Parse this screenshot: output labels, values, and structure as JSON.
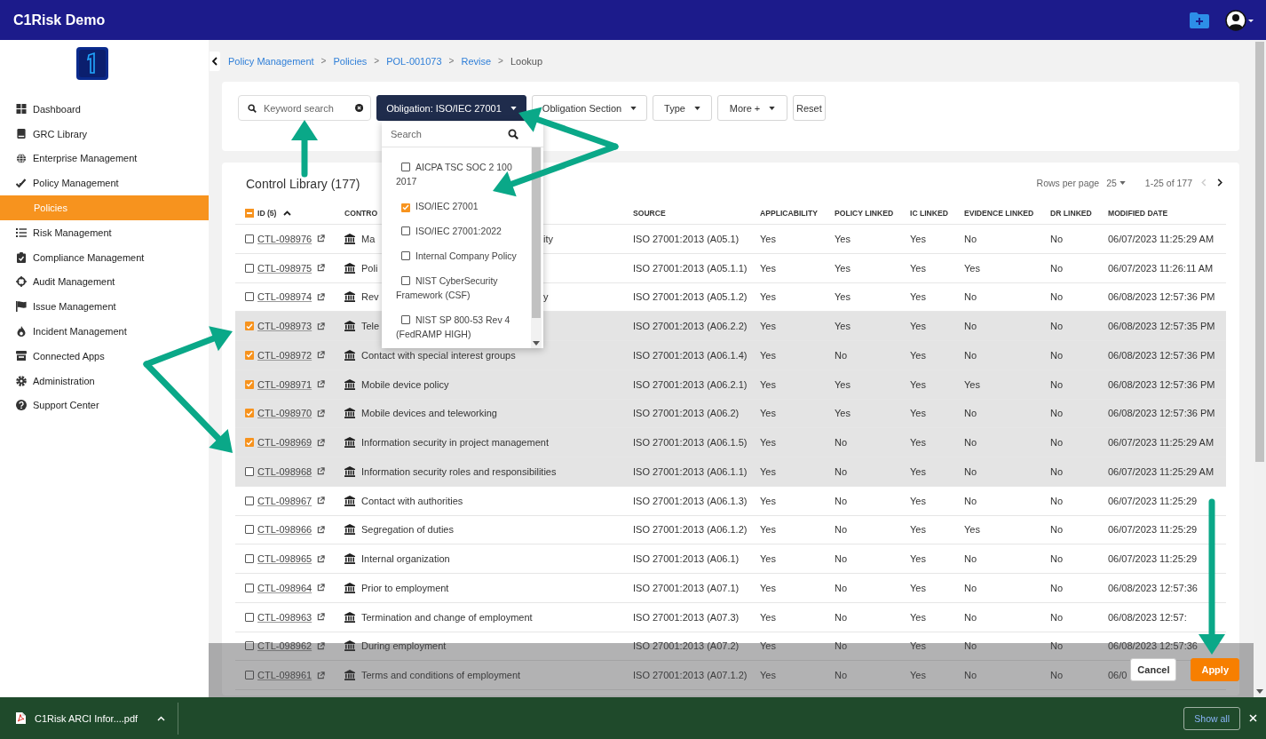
{
  "header": {
    "title": "C1Risk Demo"
  },
  "sidebar": {
    "items": [
      {
        "label": "Dashboard",
        "selected": false
      },
      {
        "label": "GRC Library",
        "selected": false
      },
      {
        "label": "Enterprise Management",
        "selected": false
      },
      {
        "label": "Policy Management",
        "selected": false,
        "children": [
          {
            "label": "Policies",
            "selected": true
          }
        ]
      },
      {
        "label": "Risk Management",
        "selected": false
      },
      {
        "label": "Compliance Management",
        "selected": false
      },
      {
        "label": "Audit Management",
        "selected": false
      },
      {
        "label": "Issue Management",
        "selected": false
      },
      {
        "label": "Incident Management",
        "selected": false
      },
      {
        "label": "Connected Apps",
        "selected": false
      },
      {
        "label": "Administration",
        "selected": false
      },
      {
        "label": "Support Center",
        "selected": false
      }
    ]
  },
  "breadcrumbs": [
    {
      "label": "Policy Management",
      "link": true
    },
    {
      "separator": ">",
      "label": "Policies",
      "link": true
    },
    {
      "separator": ">",
      "label": "POL-001073",
      "link": true
    },
    {
      "separator": ">",
      "label": "Revise",
      "link": true
    },
    {
      "separator": ">",
      "label": "Lookup",
      "link": false
    }
  ],
  "filters": {
    "search": {
      "placeholder": "Keyword search"
    },
    "buttons": [
      {
        "label": "Obligation: ISO/IEC 27001",
        "active": true
      },
      {
        "label": "Obligation Section",
        "active": false
      },
      {
        "label": "Type",
        "active": false
      },
      {
        "label": "More +",
        "active": false
      }
    ],
    "reset": "Reset",
    "dropdown": {
      "search_placeholder": "Search",
      "options": [
        {
          "label": "AICPA TSC SOC 2 100 2017",
          "checked": false
        },
        {
          "label": "ISO/IEC 27001",
          "checked": true
        },
        {
          "label": "ISO/IEC 27001:2022",
          "checked": false
        },
        {
          "label": "Internal Company Policy",
          "checked": false
        },
        {
          "label": "NIST CyberSecurity Framework (CSF)",
          "checked": false
        },
        {
          "label": "NIST SP 800-53 Rev 4 (FedRAMP HIGH)",
          "checked": false
        }
      ]
    }
  },
  "table": {
    "title": "Control Library (177)",
    "rows_per_page_label": "Rows per page",
    "rows_per_page": "25",
    "range": "1-25 of 177",
    "indeterminate": true,
    "columns": [
      "ID (5)",
      "CONTRO",
      "SOURCE",
      "APPLICABILITY",
      "POLICY LINKED",
      "IC LINKED",
      "EVIDENCE LINKED",
      "DR LINKED",
      "MODIFIED DATE"
    ],
    "rows": [
      {
        "id": "CTL-098976",
        "control": "Ma",
        "control_tail": "ity",
        "source": "ISO 27001:2013 (A05.1)",
        "applicability": "Yes",
        "policy_linked": "Yes",
        "ic_linked": "Yes",
        "evidence_linked": "No",
        "dr_linked": "No",
        "modified": "06/07/2023 11:25:29 AM",
        "checked": false,
        "selected": false
      },
      {
        "id": "CTL-098975",
        "control": "Poli",
        "source": "ISO 27001:2013 (A05.1.1)",
        "applicability": "Yes",
        "policy_linked": "Yes",
        "ic_linked": "Yes",
        "evidence_linked": "Yes",
        "dr_linked": "No",
        "modified": "06/07/2023 11:26:11 AM",
        "checked": false,
        "selected": false
      },
      {
        "id": "CTL-098974",
        "control": "Rev",
        "control_tail": "y",
        "source": "ISO 27001:2013 (A05.1.2)",
        "applicability": "Yes",
        "policy_linked": "Yes",
        "ic_linked": "Yes",
        "evidence_linked": "No",
        "dr_linked": "No",
        "modified": "06/08/2023 12:57:36 PM",
        "checked": false,
        "selected": false
      },
      {
        "id": "CTL-098973",
        "control": "Tele",
        "source": "ISO 27001:2013 (A06.2.2)",
        "applicability": "Yes",
        "policy_linked": "Yes",
        "ic_linked": "Yes",
        "evidence_linked": "No",
        "dr_linked": "No",
        "modified": "06/08/2023 12:57:35 PM",
        "checked": true,
        "selected": true
      },
      {
        "id": "CTL-098972",
        "control": "Contact with special interest groups",
        "source": "ISO 27001:2013 (A06.1.4)",
        "applicability": "Yes",
        "policy_linked": "No",
        "ic_linked": "Yes",
        "evidence_linked": "No",
        "dr_linked": "No",
        "modified": "06/08/2023 12:57:36 PM",
        "checked": true,
        "selected": true
      },
      {
        "id": "CTL-098971",
        "control": "Mobile device policy",
        "source": "ISO 27001:2013 (A06.2.1)",
        "applicability": "Yes",
        "policy_linked": "Yes",
        "ic_linked": "Yes",
        "evidence_linked": "Yes",
        "dr_linked": "No",
        "modified": "06/08/2023 12:57:36 PM",
        "checked": true,
        "selected": true
      },
      {
        "id": "CTL-098970",
        "control": "Mobile devices and teleworking",
        "source": "ISO 27001:2013 (A06.2)",
        "applicability": "Yes",
        "policy_linked": "Yes",
        "ic_linked": "Yes",
        "evidence_linked": "No",
        "dr_linked": "No",
        "modified": "06/08/2023 12:57:36 PM",
        "checked": true,
        "selected": true
      },
      {
        "id": "CTL-098969",
        "control": "Information security in project management",
        "source": "ISO 27001:2013 (A06.1.5)",
        "applicability": "Yes",
        "policy_linked": "No",
        "ic_linked": "Yes",
        "evidence_linked": "No",
        "dr_linked": "No",
        "modified": "06/07/2023 11:25:29 AM",
        "checked": true,
        "selected": true
      },
      {
        "id": "CTL-098968",
        "control": "Information security roles and responsibilities",
        "source": "ISO 27001:2013 (A06.1.1)",
        "applicability": "Yes",
        "policy_linked": "No",
        "ic_linked": "Yes",
        "evidence_linked": "No",
        "dr_linked": "No",
        "modified": "06/07/2023 11:25:29 AM",
        "checked": false,
        "selected": true
      },
      {
        "id": "CTL-098967",
        "control": "Contact with authorities",
        "source": "ISO 27001:2013 (A06.1.3)",
        "applicability": "Yes",
        "policy_linked": "No",
        "ic_linked": "Yes",
        "evidence_linked": "No",
        "dr_linked": "No",
        "modified": "06/07/2023 11:25:29",
        "checked": false,
        "selected": false
      },
      {
        "id": "CTL-098966",
        "control": "Segregation of duties",
        "source": "ISO 27001:2013 (A06.1.2)",
        "applicability": "Yes",
        "policy_linked": "No",
        "ic_linked": "Yes",
        "evidence_linked": "Yes",
        "dr_linked": "No",
        "modified": "06/07/2023 11:25:29",
        "checked": false,
        "selected": false
      },
      {
        "id": "CTL-098965",
        "control": "Internal organization",
        "source": "ISO 27001:2013 (A06.1)",
        "applicability": "Yes",
        "policy_linked": "No",
        "ic_linked": "Yes",
        "evidence_linked": "No",
        "dr_linked": "No",
        "modified": "06/07/2023 11:25:29",
        "checked": false,
        "selected": false
      },
      {
        "id": "CTL-098964",
        "control": "Prior to employment",
        "source": "ISO 27001:2013 (A07.1)",
        "applicability": "Yes",
        "policy_linked": "No",
        "ic_linked": "Yes",
        "evidence_linked": "No",
        "dr_linked": "No",
        "modified": "06/08/2023 12:57:36",
        "checked": false,
        "selected": false
      },
      {
        "id": "CTL-098963",
        "control": "Termination and change of employment",
        "source": "ISO 27001:2013 (A07.3)",
        "applicability": "Yes",
        "policy_linked": "No",
        "ic_linked": "Yes",
        "evidence_linked": "No",
        "dr_linked": "No",
        "modified": "06/08/2023 12:57:",
        "checked": false,
        "selected": false
      },
      {
        "id": "CTL-098962",
        "control": "During employment",
        "source": "ISO 27001:2013 (A07.2)",
        "applicability": "Yes",
        "policy_linked": "No",
        "ic_linked": "Yes",
        "evidence_linked": "No",
        "dr_linked": "No",
        "modified": "06/08/2023 12:57:36",
        "checked": false,
        "selected": false
      },
      {
        "id": "CTL-098961",
        "control": "Terms and conditions of employment",
        "source": "ISO 27001:2013 (A07.1.2)",
        "applicability": "Yes",
        "policy_linked": "No",
        "ic_linked": "Yes",
        "evidence_linked": "No",
        "dr_linked": "No",
        "modified": "06/0",
        "checked": false,
        "selected": false
      }
    ]
  },
  "actions": {
    "cancel": "Cancel",
    "apply": "Apply"
  },
  "downloads": {
    "file": "C1Risk ARCI Infor....pdf",
    "show_all": "Show all"
  }
}
